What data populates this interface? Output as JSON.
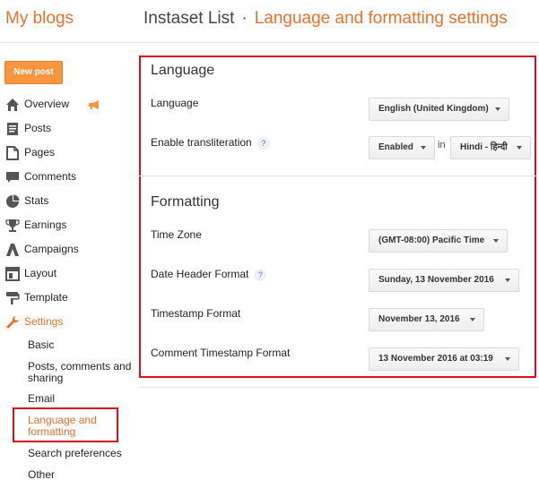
{
  "header": {
    "brand": "My blogs",
    "blog_title": "Instaset List",
    "separator": "·",
    "page_title": "Language and formatting settings"
  },
  "new_post_label": "New post",
  "nav": {
    "items": [
      {
        "label": "Overview",
        "icon": "home-icon"
      },
      {
        "label": "Posts",
        "icon": "posts-icon"
      },
      {
        "label": "Pages",
        "icon": "pages-icon"
      },
      {
        "label": "Comments",
        "icon": "comments-icon"
      },
      {
        "label": "Stats",
        "icon": "stats-icon"
      },
      {
        "label": "Earnings",
        "icon": "trophy-icon"
      },
      {
        "label": "Campaigns",
        "icon": "campaigns-icon"
      },
      {
        "label": "Layout",
        "icon": "layout-icon"
      },
      {
        "label": "Template",
        "icon": "template-icon"
      },
      {
        "label": "Settings",
        "icon": "wrench-icon"
      }
    ],
    "sub_items": [
      {
        "label": "Basic"
      },
      {
        "label": "Posts, comments and sharing"
      },
      {
        "label": "Email"
      },
      {
        "label": "Language and formatting"
      },
      {
        "label": "Search preferences"
      },
      {
        "label": "Other"
      }
    ]
  },
  "language_section": {
    "heading": "Language",
    "language_label": "Language",
    "language_value": "English (United Kingdom)",
    "translit_label": "Enable transliteration",
    "translit_help": "?",
    "translit_value": "Enabled",
    "in_word": "in",
    "translit_lang": "Hindi - हिन्दी"
  },
  "formatting_section": {
    "heading": "Formatting",
    "timezone_label": "Time Zone",
    "timezone_value": "(GMT-08:00) Pacific Time",
    "date_header_label": "Date Header Format",
    "date_header_help": "?",
    "date_header_value": "Sunday, 13 November 2016",
    "timestamp_label": "Timestamp Format",
    "timestamp_value": "November 13, 2016",
    "comment_ts_label": "Comment Timestamp Format",
    "comment_ts_value": "13 November 2016 at 03:19"
  },
  "colors": {
    "accent": "#e8702a",
    "button": "#f8963f",
    "highlight_border": "#d9101c"
  }
}
